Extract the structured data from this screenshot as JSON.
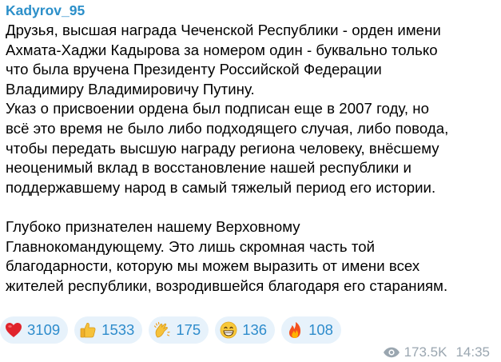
{
  "post": {
    "channel_name": "Kadyrov_95",
    "message_lines": [
      "Друзья, высшая награда Чеченской Республики - орден имени",
      "Ахмата-Хаджи Кадырова за номером один - буквально только",
      "что была вручена Президенту Российской Федерации",
      "Владимиру Владимировичу Путину.",
      "Указ о присвоении ордена был подписан еще в 2007 году, но",
      "всё это время не было либо подходящего случая, либо повода,",
      "чтобы передать высшую награду региона человеку, внёсшему",
      "неоценимый вклад в восстановление нашей республики и",
      "поддержавшему народ в самый тяжелый период его истории.",
      "",
      "Глубоко признателен нашему Верховному",
      "Главнокомандующему. Это лишь скромная часть той",
      "благодарности, которую мы можем выразить от имени всех",
      "жителей республики, возродившейся благодаря его стараниям."
    ],
    "reactions": [
      {
        "icon": "red-heart-icon",
        "count": "3109"
      },
      {
        "icon": "thumbs-up-icon",
        "count": "1533"
      },
      {
        "icon": "clapping-hands-icon",
        "count": "175"
      },
      {
        "icon": "grinning-face-icon",
        "count": "136"
      },
      {
        "icon": "fire-icon",
        "count": "108"
      }
    ],
    "views": "173.5K",
    "time": "14:35"
  },
  "colors": {
    "channel_name": "#2b8fc9",
    "reaction_bg": "#e7f2fb",
    "reaction_count": "#2e8ccc",
    "meta": "#9aa6b0"
  }
}
